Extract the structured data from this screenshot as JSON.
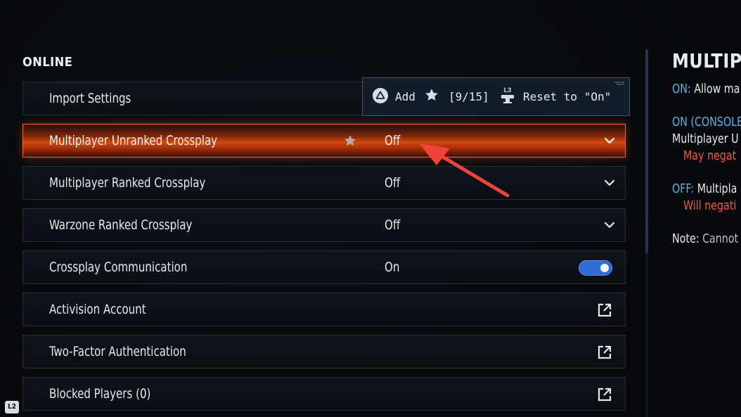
{
  "section": {
    "title": "ONLINE"
  },
  "rows": [
    {
      "label": "Import Settings",
      "value": "",
      "control": "none"
    },
    {
      "label": "Multiplayer Unranked Crossplay",
      "value": "Off",
      "control": "dropdown",
      "selected": true,
      "favorite": true
    },
    {
      "label": "Multiplayer Ranked Crossplay",
      "value": "Off",
      "control": "dropdown"
    },
    {
      "label": "Warzone Ranked Crossplay",
      "value": "Off",
      "control": "dropdown"
    },
    {
      "label": "Crossplay Communication",
      "value": "On",
      "control": "toggle",
      "toggle_on": true
    },
    {
      "label": "Activision Account",
      "value": "",
      "control": "external-link"
    },
    {
      "label": "Two-Factor Authentication",
      "value": "",
      "control": "external-link"
    },
    {
      "label": "Blocked Players (0)",
      "value": "",
      "control": "external-link"
    }
  ],
  "popup": {
    "add_label": "Add",
    "count": "[9/15]",
    "l3_label": "L3",
    "reset_label": "Reset to \"On\""
  },
  "right_panel": {
    "title": "MULTIP",
    "on_key": "ON:",
    "on_text": "Allow ma",
    "on_console_key": "ON (CONSOLE",
    "on_console_text": "Multiplayer U",
    "on_console_warning": "May negat",
    "off_key": "OFF:",
    "off_text": "Multipla",
    "off_warning": "Will negati",
    "note_key": "Note:",
    "note_text": "Cannot"
  },
  "corner_badge": {
    "label": "L2"
  },
  "colors": {
    "selected_row": "#d4480f",
    "toggle_on": "#2e6cd6",
    "panel_key": "#4fb6e6",
    "warning": "#f25a3c",
    "annotation_arrow": "#f0443a"
  }
}
